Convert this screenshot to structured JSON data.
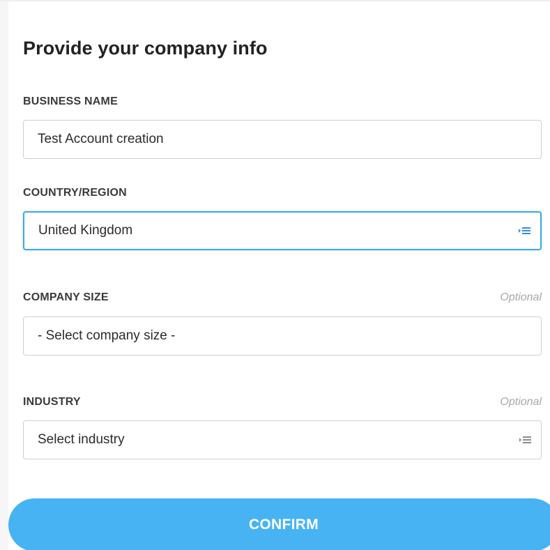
{
  "form": {
    "title": "Provide your company info",
    "business_name": {
      "label": "BUSINESS NAME",
      "value": "Test Account creation"
    },
    "country_region": {
      "label": "COUNTRY/REGION",
      "value": "United Kingdom",
      "icon": "list-picker-icon"
    },
    "company_size": {
      "label": "COMPANY SIZE",
      "optional_label": "Optional",
      "value": "- Select company size -"
    },
    "industry": {
      "label": "INDUSTRY",
      "optional_label": "Optional",
      "value": "Select industry",
      "icon": "list-picker-icon"
    },
    "confirm_label": "CONFIRM"
  },
  "colors": {
    "accent": "#47b3f3",
    "focus_border": "#3fa9e8",
    "icon_active": "#2f8fd6",
    "icon_inactive": "#8a8a8a"
  }
}
